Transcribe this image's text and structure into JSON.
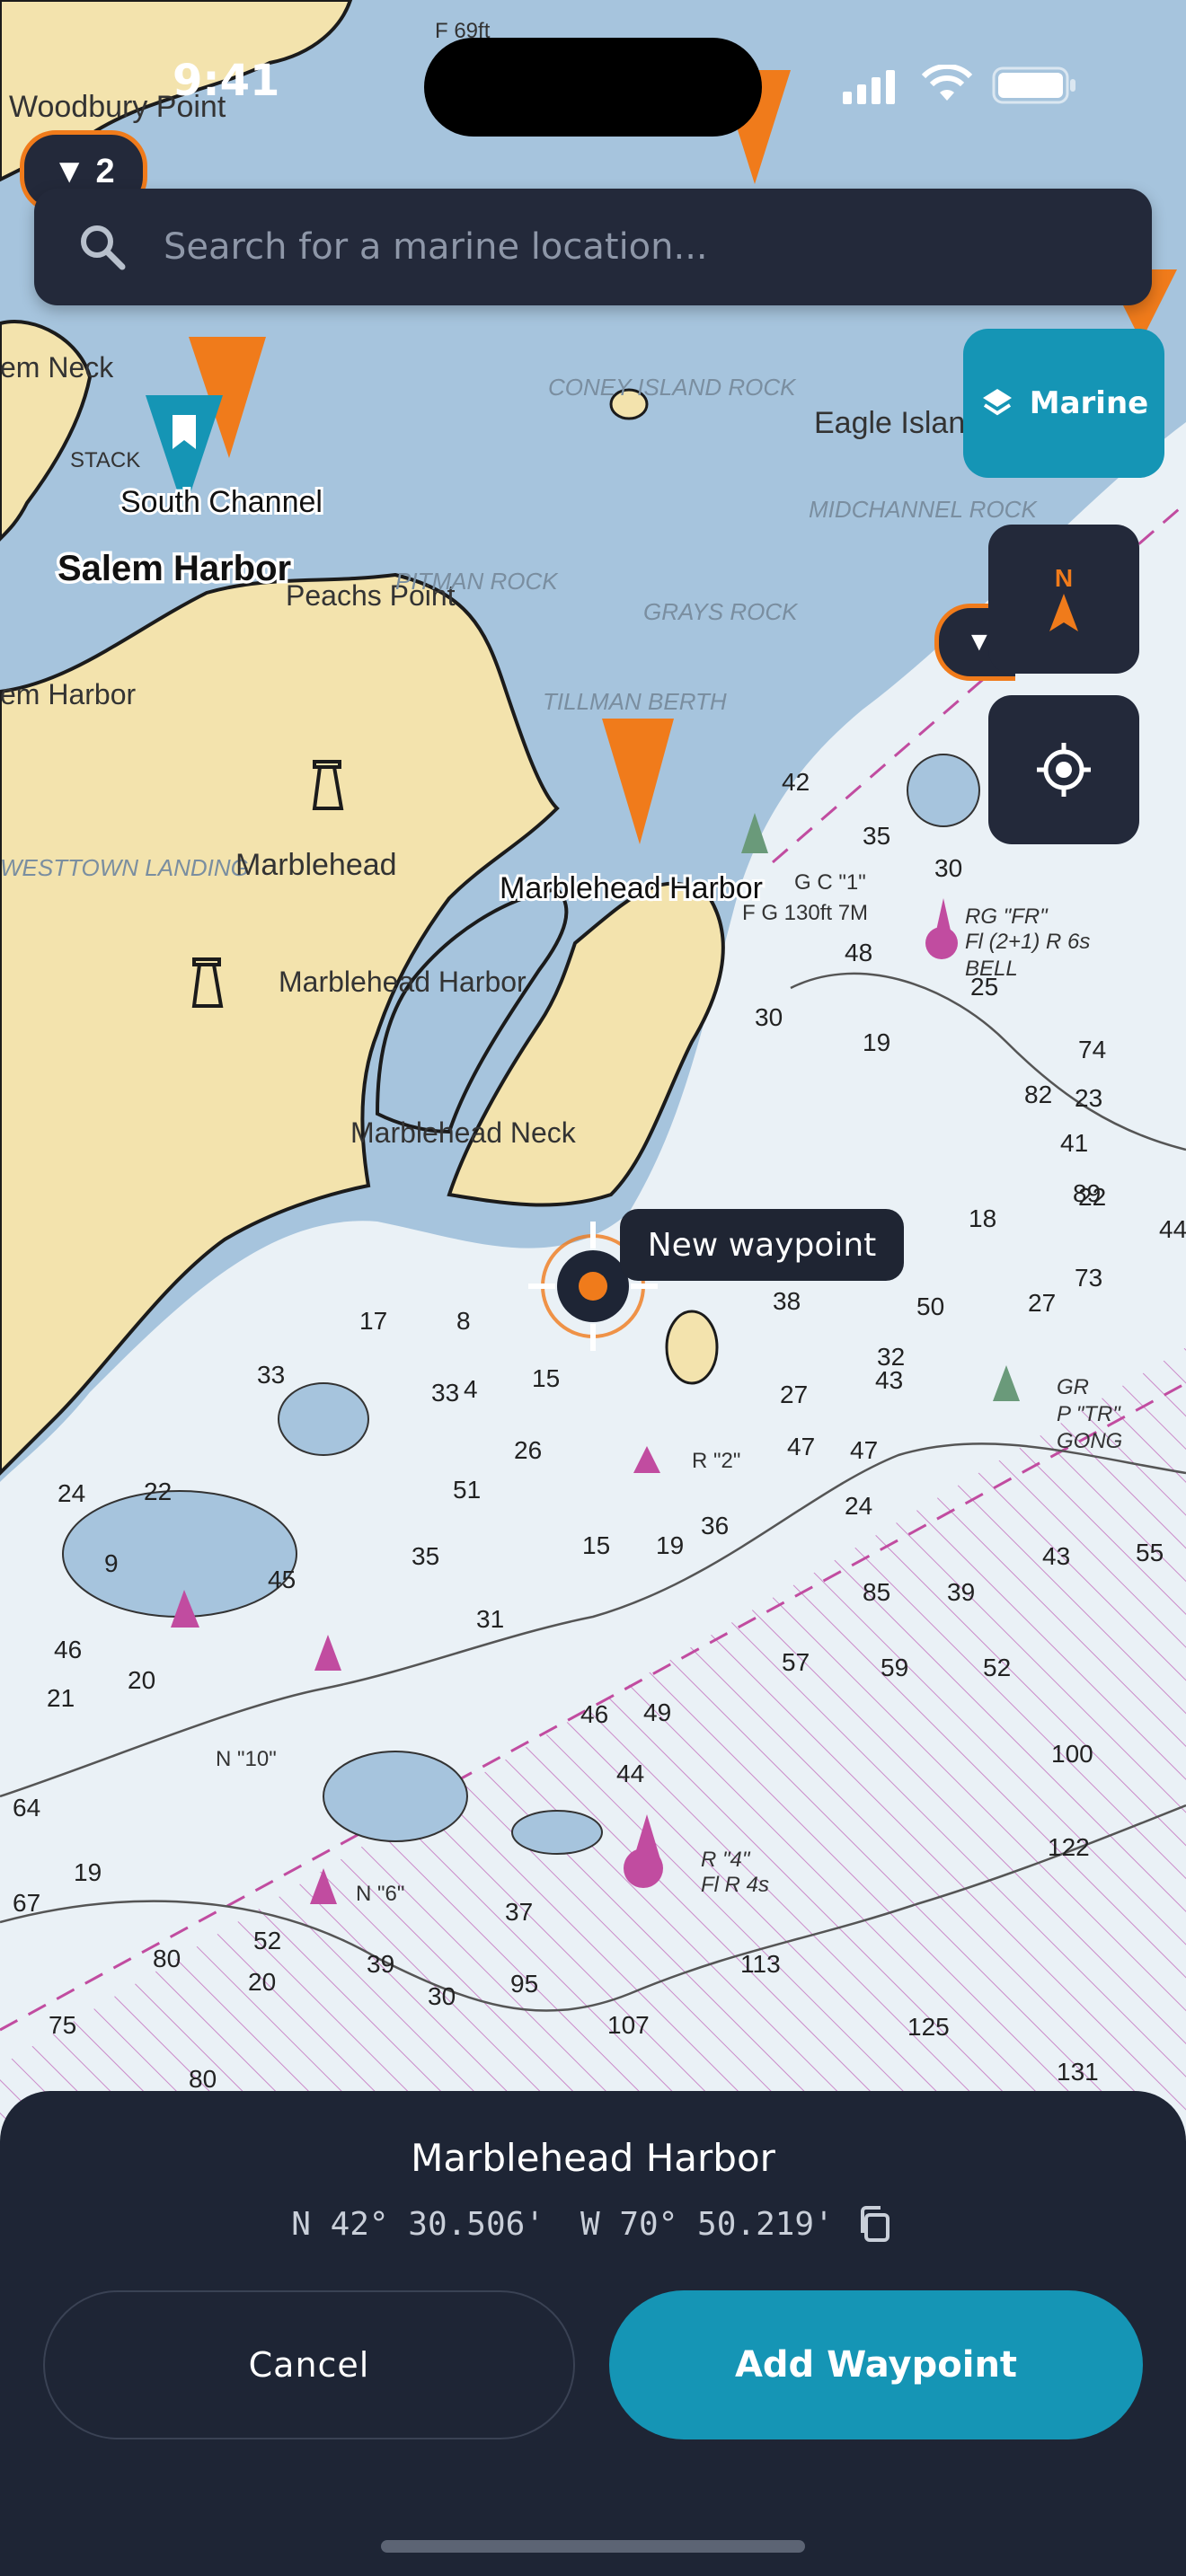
{
  "status_bar": {
    "time": "9:41"
  },
  "search": {
    "placeholder": "Search for a marine location..."
  },
  "filter_badge": {
    "label": "▼ 2"
  },
  "layer_button": {
    "label": "Marine"
  },
  "compass": {
    "label": "N"
  },
  "partial_badge": {
    "label": "▼"
  },
  "map": {
    "place_labels": {
      "woodbury_point": "Woodbury Point",
      "south_channel": "South Channel",
      "salem_harbor": "Salem Harbor",
      "peachs_point": "Peachs Point",
      "em_harbor": "em Harbor",
      "em_neck": "em Neck",
      "marblehead": "Marblehead",
      "marblehead_harbor_land": "Marblehead Harbor",
      "marblehead_neck": "Marblehead Neck",
      "marblehead_harbor_marker": "Marblehead Harbor",
      "eagle_island": "Eagle Islan",
      "coney_island_rock": "CONEY ISLAND ROCK",
      "midchannel_rock": "MIDCHANNEL ROCK",
      "pitman_rock": "PITMAN ROCK",
      "grays_rock": "GRAYS ROCK",
      "tillman_berth": "TILLMAN BERTH",
      "westtown_landing": "WESTTOWN LANDING",
      "stack": "STACK",
      "f69ft": "F 69ft",
      "light_g1": "G C \"1\"",
      "light_fg": "F G 130ft 7M",
      "bell_rg": "RG \"FR\"",
      "bell_fl": "Fl (2+1) R 6s",
      "bell": "BELL",
      "gong_gr": "GR",
      "gong_p": "P \"TR\"",
      "gong": "GONG",
      "r2": "R \"2\"",
      "r4": "R \"4\"",
      "flr4s": "Fl R 4s",
      "n6": "N \"6\"",
      "n10": "N \"10\""
    },
    "soundings": [
      "42",
      "35",
      "30",
      "48",
      "30",
      "19",
      "25",
      "82",
      "74",
      "41",
      "22",
      "23",
      "89",
      "18",
      "44",
      "50",
      "73",
      "27",
      "38",
      "43",
      "27",
      "47",
      "47",
      "24",
      "36",
      "32",
      "85",
      "39",
      "43",
      "55",
      "57",
      "59",
      "52",
      "100",
      "122",
      "113",
      "125",
      "131",
      "107",
      "95",
      "37",
      "44",
      "46",
      "49",
      "31",
      "19",
      "15",
      "51",
      "35",
      "26",
      "15",
      "33",
      "17",
      "8",
      "4",
      "33",
      "24",
      "22",
      "9",
      "45",
      "46",
      "21",
      "20",
      "64",
      "19",
      "67",
      "80",
      "75",
      "52",
      "20",
      "39",
      "30",
      "80"
    ]
  },
  "tooltip": {
    "label": "New waypoint"
  },
  "sheet": {
    "title": "Marblehead Harbor",
    "lat": "N 42° 30.506'",
    "lon": "W 70° 50.219'",
    "cancel_label": "Cancel",
    "add_label": "Add Waypoint"
  },
  "colors": {
    "water_deep": "#eaf1f6",
    "water_shallow": "#a6c4dd",
    "land": "#f3e3ad",
    "accent": "#1595b5",
    "marker_orange": "#f07b1b",
    "dark_panel": "#1e2535",
    "restricted_magenta": "#c14ca0"
  }
}
